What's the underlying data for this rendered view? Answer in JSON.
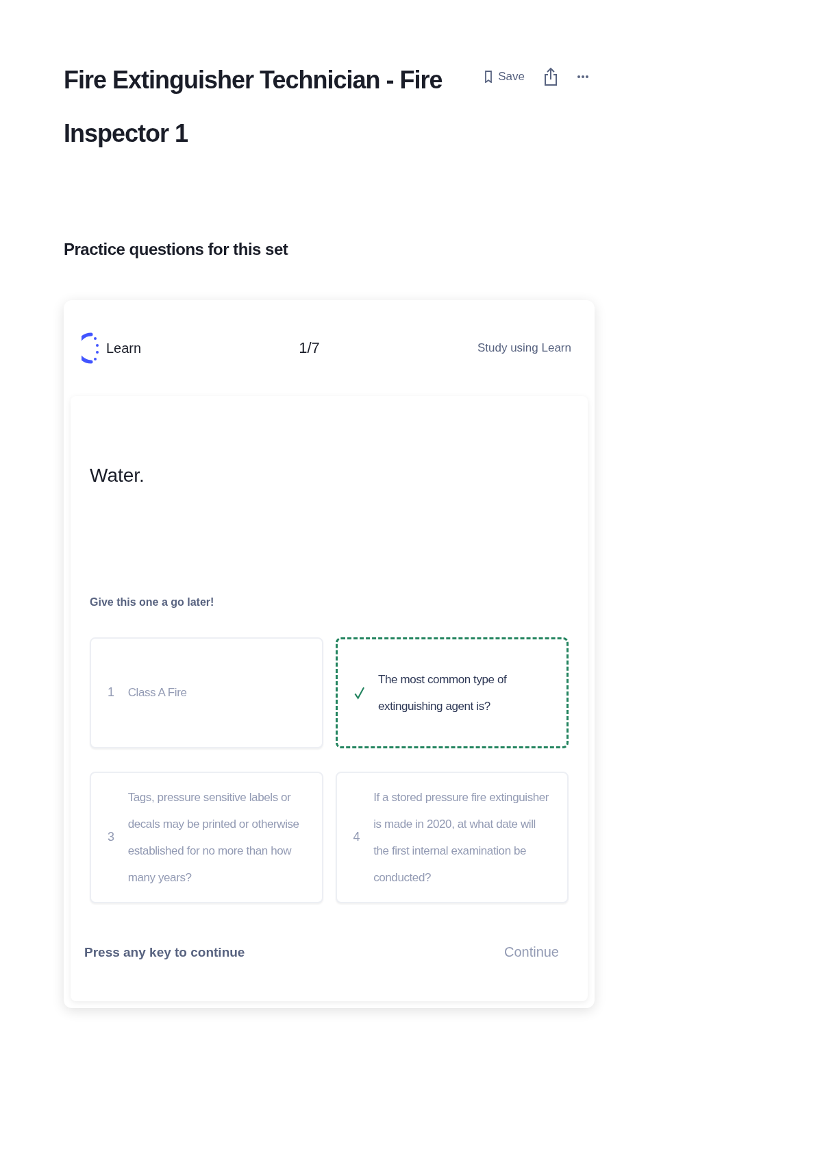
{
  "header": {
    "title": "Fire Extinguisher Technician - Fire Inspector 1",
    "save_label": "Save"
  },
  "section_title": "Practice questions for this set",
  "learn_card": {
    "mode": "Learn",
    "progress": "1/7",
    "study_link": "Study using Learn",
    "prompt": "Water.",
    "hint": "Give this one a go later!",
    "options": [
      {
        "number": "1",
        "text": "Class A Fire",
        "correct": false
      },
      {
        "text": "The most common type of extinguishing agent is?",
        "correct": true
      },
      {
        "number": "3",
        "text": "Tags, pressure sensitive labels or decals may be printed or otherwise established for no more than how many years?",
        "correct": false
      },
      {
        "number": "4",
        "text": "If a stored pressure fire extinguisher is made in 2020, at what date will the first internal examination be conducted?",
        "correct": false
      }
    ],
    "footer_note": "Press any key to continue",
    "continue_label": "Continue"
  }
}
